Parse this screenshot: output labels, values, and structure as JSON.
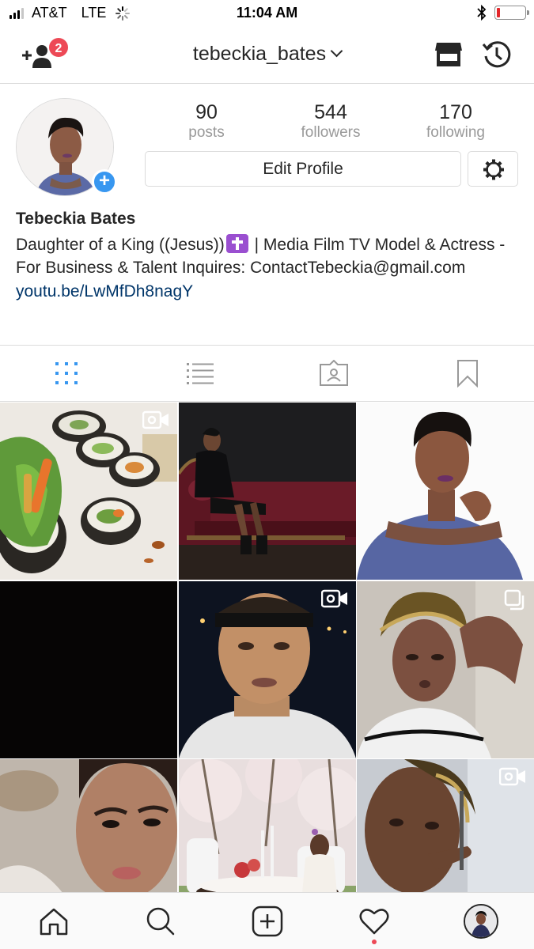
{
  "status_bar": {
    "carrier": "AT&T",
    "network": "LTE",
    "time": "11:04 AM",
    "battery_color": "#e3262a"
  },
  "header": {
    "username": "tebeckia_bates",
    "follow_requests_badge": "2",
    "icons": [
      "add-user-icon",
      "chevron-down-icon",
      "shop-icon",
      "history-icon"
    ]
  },
  "profile": {
    "stats": [
      {
        "number": "90",
        "label": "posts"
      },
      {
        "number": "544",
        "label": "followers"
      },
      {
        "number": "170",
        "label": "following"
      }
    ],
    "edit_profile_label": "Edit Profile",
    "name": "Tebeckia Bates",
    "bio_part1": "Daughter of a King ((Jesus))",
    "bio_part2": " | Media Film TV Model & Actress - For Business & Talent Inquires: ContactTebeckia@gmail.com",
    "link": "youtu.be/LwMfDh8nagY"
  },
  "tabs": [
    "grid-icon",
    "list-icon",
    "tagged-icon",
    "saved-icon"
  ],
  "accent_color": "#3897f0",
  "grid": [
    {
      "name": "sushi-rolls",
      "indicator": "video-icon"
    },
    {
      "name": "model-on-sofa",
      "indicator": ""
    },
    {
      "name": "portrait-blue-top",
      "indicator": ""
    },
    {
      "name": "dark-photo",
      "indicator": ""
    },
    {
      "name": "selfie-headband",
      "indicator": "video-icon"
    },
    {
      "name": "selfie-car",
      "indicator": "carousel-icon"
    },
    {
      "name": "selfie-closeup",
      "indicator": ""
    },
    {
      "name": "tea-party-blossoms",
      "indicator": ""
    },
    {
      "name": "selfie-outdoor",
      "indicator": "video-icon"
    }
  ],
  "bottom_nav": [
    "home-icon",
    "search-icon",
    "new-post-icon",
    "activity-heart-icon",
    "profile-avatar"
  ]
}
